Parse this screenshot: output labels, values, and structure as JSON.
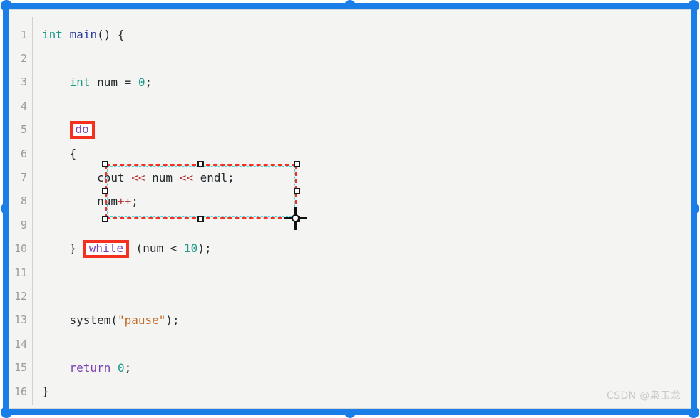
{
  "editor": {
    "background_color": "#f4f5f2",
    "lines": [
      {
        "no": "1",
        "tokens": [
          {
            "t": "int",
            "c": "tok-type"
          },
          {
            "t": " ",
            "c": "tok-punct"
          },
          {
            "t": "main",
            "c": "tok-fn"
          },
          {
            "t": "() {",
            "c": "tok-punct"
          }
        ]
      },
      {
        "no": "2",
        "tokens": []
      },
      {
        "no": "3",
        "tokens": [
          {
            "t": "    ",
            "c": "tok-punct"
          },
          {
            "t": "int",
            "c": "tok-type"
          },
          {
            "t": " ",
            "c": "tok-punct"
          },
          {
            "t": "num",
            "c": "tok-ident"
          },
          {
            "t": " = ",
            "c": "tok-op"
          },
          {
            "t": "0",
            "c": "tok-num"
          },
          {
            "t": ";",
            "c": "tok-punct"
          }
        ]
      },
      {
        "no": "4",
        "tokens": []
      },
      {
        "no": "5",
        "tokens": [
          {
            "t": "    ",
            "c": "tok-punct"
          }
        ],
        "boxed": {
          "text": "do",
          "class": "tok-kw"
        }
      },
      {
        "no": "6",
        "tokens": [
          {
            "t": "    {",
            "c": "tok-punct"
          }
        ]
      },
      {
        "no": "7",
        "tokens": [
          {
            "t": "        ",
            "c": "tok-punct"
          },
          {
            "t": "cout",
            "c": "tok-ident"
          },
          {
            "t": " ",
            "c": "tok-punct"
          },
          {
            "t": "<<",
            "c": "tok-shift"
          },
          {
            "t": " ",
            "c": "tok-punct"
          },
          {
            "t": "num",
            "c": "tok-ident"
          },
          {
            "t": " ",
            "c": "tok-punct"
          },
          {
            "t": "<<",
            "c": "tok-shift"
          },
          {
            "t": " ",
            "c": "tok-punct"
          },
          {
            "t": "endl",
            "c": "tok-ident"
          },
          {
            "t": ";",
            "c": "tok-punct"
          }
        ]
      },
      {
        "no": "8",
        "tokens": [
          {
            "t": "        ",
            "c": "tok-punct"
          },
          {
            "t": "num",
            "c": "tok-ident"
          },
          {
            "t": "++",
            "c": "tok-plus"
          },
          {
            "t": ";",
            "c": "tok-punct"
          }
        ]
      },
      {
        "no": "9",
        "tokens": []
      },
      {
        "no": "10",
        "tokens": [
          {
            "t": "    } ",
            "c": "tok-punct"
          }
        ],
        "boxed": {
          "text": "while",
          "class": "tok-kw"
        },
        "after": [
          {
            "t": " (",
            "c": "tok-punct"
          },
          {
            "t": "num",
            "c": "tok-ident"
          },
          {
            "t": " < ",
            "c": "tok-op"
          },
          {
            "t": "10",
            "c": "tok-num"
          },
          {
            "t": ");",
            "c": "tok-punct"
          }
        ]
      },
      {
        "no": "11",
        "tokens": []
      },
      {
        "no": "12",
        "tokens": []
      },
      {
        "no": "13",
        "tokens": [
          {
            "t": "    ",
            "c": "tok-punct"
          },
          {
            "t": "system",
            "c": "tok-ident"
          },
          {
            "t": "(",
            "c": "tok-punct"
          },
          {
            "t": "\"pause\"",
            "c": "tok-str"
          },
          {
            "t": ");",
            "c": "tok-punct"
          }
        ]
      },
      {
        "no": "14",
        "tokens": []
      },
      {
        "no": "15",
        "tokens": [
          {
            "t": "    ",
            "c": "tok-punct"
          },
          {
            "t": "return",
            "c": "tok-kw"
          },
          {
            "t": " ",
            "c": "tok-punct"
          },
          {
            "t": "0",
            "c": "tok-num"
          },
          {
            "t": ";",
            "c": "tok-punct"
          }
        ]
      },
      {
        "no": "16",
        "tokens": [
          {
            "t": "}",
            "c": "tok-punct"
          }
        ]
      }
    ]
  },
  "annotations": {
    "box_color": "#f5301e",
    "boxed_keywords": [
      "do",
      "while"
    ]
  },
  "crop_selection": {
    "border_color": "#f5301e",
    "dash_color": "#4fd0e0",
    "handle_fill": "#ffffff",
    "handle_stroke": "#1a1a1a"
  },
  "image_frame": {
    "color": "#1a7ee8"
  },
  "watermark": {
    "text": "CSDN @枭玉龙"
  }
}
